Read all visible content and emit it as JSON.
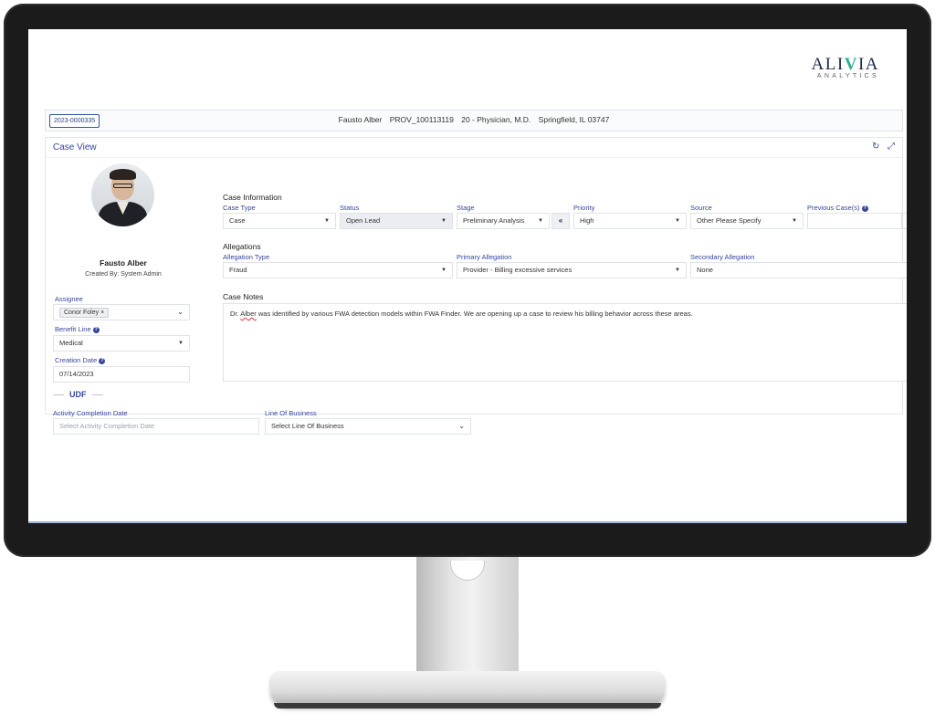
{
  "logo": {
    "prefix": "ALI",
    "accent": "V",
    "suffix": "IA",
    "sub": "ANALYTICS"
  },
  "provider_bar": {
    "case_id": "2023-0000335",
    "name": "Fausto Alber",
    "provider_id": "PROV_100113119",
    "specialty": "20 - Physician, M.D.",
    "location": "Springfield, IL 03747"
  },
  "case_view": {
    "title": "Case View",
    "refresh_icon": "↻",
    "expand_icon": "⤢"
  },
  "profile": {
    "name": "Fausto Alber",
    "created_by": "Created By: System Admin"
  },
  "assignee": {
    "label": "Assignee",
    "chip": "Conor Foley ×"
  },
  "benefit_line": {
    "label": "Benefit Line",
    "help": "?",
    "value": "Medical"
  },
  "creation_date": {
    "label": "Creation Date",
    "help": "?",
    "value": "07/14/2023"
  },
  "case_information": {
    "heading": "Case Information",
    "case_type": {
      "label": "Case Type",
      "value": "Case"
    },
    "status": {
      "label": "Status",
      "value": "Open Lead"
    },
    "stage": {
      "label": "Stage",
      "value": "Preliminary Analysis",
      "button": "«"
    },
    "priority": {
      "label": "Priority",
      "value": "High"
    },
    "source": {
      "label": "Source",
      "value": "Other Please Specify"
    },
    "previous_cases": {
      "label": "Previous Case(s)",
      "help": "?",
      "search_icon": "⌕"
    }
  },
  "allegations": {
    "heading": "Allegations",
    "type": {
      "label": "Allegation Type",
      "value": "Fraud"
    },
    "primary": {
      "label": "Primary Allegation",
      "value": "Provider - Billing excessive services"
    },
    "secondary": {
      "label": "Secondary Allegation",
      "value": "None"
    }
  },
  "case_notes": {
    "heading": "Case Notes",
    "text_prefix": "Dr. ",
    "text_flagged": "Alber",
    "text_rest": " was identified by various FWA detection models within FWA Finder. We are opening up a case to review his billing behavior across these areas."
  },
  "udf": {
    "title": "UDF",
    "activity_completion": {
      "label": "Activity Completion Date",
      "placeholder": "Select Activity Completion Date"
    },
    "line_of_business": {
      "label": "Line Of Business",
      "placeholder": "Select Line Of Business"
    }
  },
  "colors": {
    "accent": "#36469b",
    "brand_teal": "#2fae8f",
    "bezel": "#1b1b1b"
  }
}
